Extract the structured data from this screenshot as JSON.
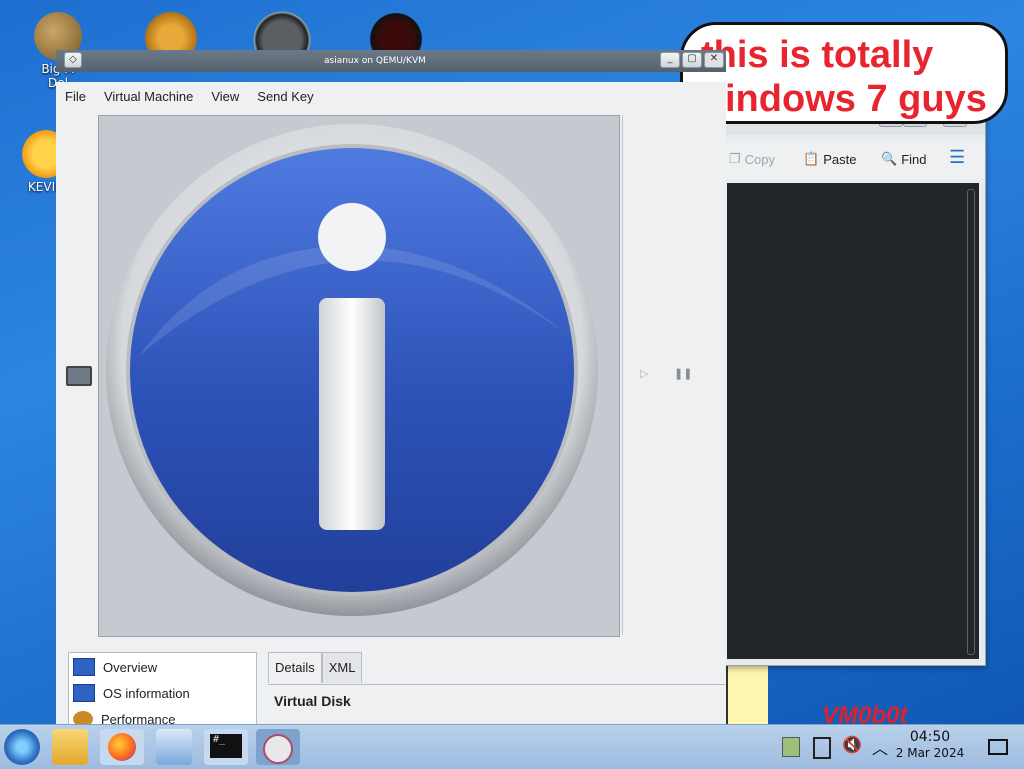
{
  "desktop": {
    "icons": [
      {
        "label": "Big M",
        "label2": "Del",
        "icon": "moneybag-icon"
      },
      {
        "label": "KEVIN",
        "icon": "sun-icon"
      }
    ],
    "top_icons": [
      "gear-app-icon",
      "gauge-icon",
      "dark-app-icon"
    ]
  },
  "bubble": {
    "line1": "this is totally",
    "line2": "indows 7 guys"
  },
  "terminal_window": {
    "toolbar": {
      "copy": "Copy",
      "paste": "Paste",
      "find": "Find"
    }
  },
  "vm_window": {
    "title": "asianux on QEMU/KVM",
    "menu": [
      "File",
      "Virtual Machine",
      "View",
      "Send Key"
    ],
    "side_items": [
      "Overview",
      "OS information",
      "Performance"
    ],
    "tabs": [
      "Details",
      "XML"
    ],
    "section_heading": "Virtual Disk"
  },
  "wallpaper_text": "VM0b0t",
  "taskbar": {
    "time": "04:50",
    "date": "2 Mar 2024",
    "terminal_icon_text": "#_"
  },
  "colors": {
    "bubble_text": "#e8252f",
    "info_blue": "#2d52b8",
    "wallpaper": "#1e6fd0"
  }
}
